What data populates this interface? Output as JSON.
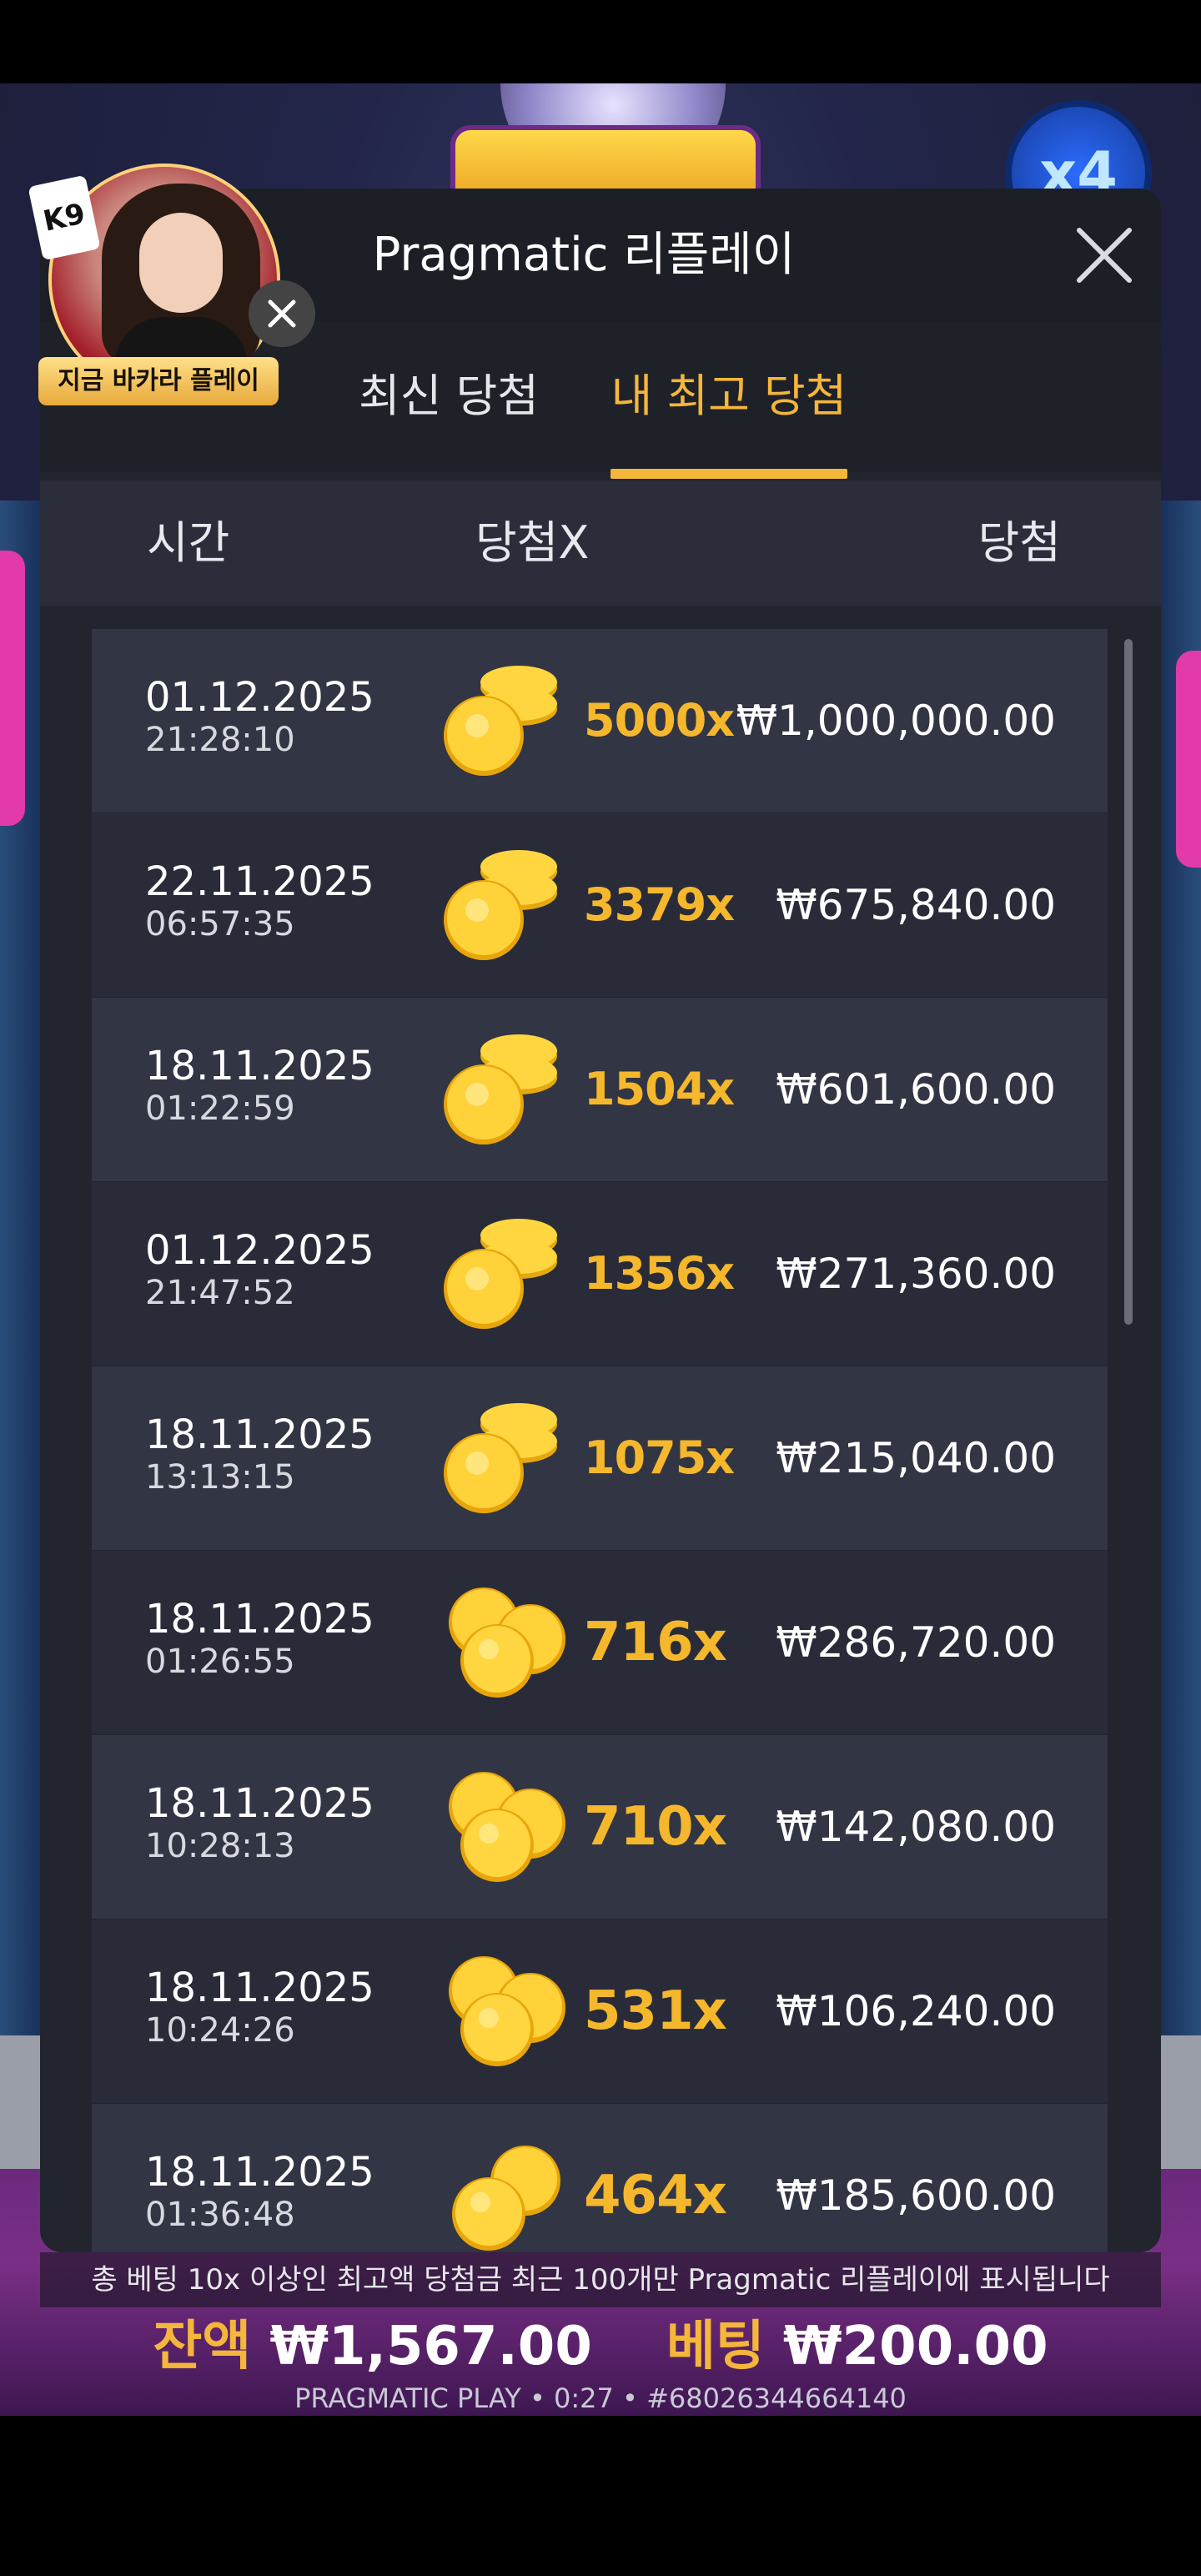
{
  "modal": {
    "title": "Pragmatic 리플레이",
    "tabs": [
      {
        "label": "최신 당첨",
        "active": false
      },
      {
        "label": "내 최고 당첨",
        "active": true
      }
    ],
    "columns": {
      "time": "시간",
      "multiplier": "당첨X",
      "win": "당첨"
    },
    "rows": [
      {
        "date": "01.12.2025",
        "time": "21:28:10",
        "multiplier": "5000x",
        "win": "₩1,000,000.00",
        "coin_icon": "coin-stack-icon"
      },
      {
        "date": "22.11.2025",
        "time": "06:57:35",
        "multiplier": "3379x",
        "win": "₩675,840.00",
        "coin_icon": "coin-stack-icon"
      },
      {
        "date": "18.11.2025",
        "time": "01:22:59",
        "multiplier": "1504x",
        "win": "₩601,600.00",
        "coin_icon": "coin-stack-icon"
      },
      {
        "date": "01.12.2025",
        "time": "21:47:52",
        "multiplier": "1356x",
        "win": "₩271,360.00",
        "coin_icon": "coin-stack-icon"
      },
      {
        "date": "18.11.2025",
        "time": "13:13:15",
        "multiplier": "1075x",
        "win": "₩215,040.00",
        "coin_icon": "coin-stack-icon"
      },
      {
        "date": "18.11.2025",
        "time": "01:26:55",
        "multiplier": "716x",
        "win": "₩286,720.00",
        "coin_icon": "coin-pile-icon"
      },
      {
        "date": "18.11.2025",
        "time": "10:28:13",
        "multiplier": "710x",
        "win": "₩142,080.00",
        "coin_icon": "coin-pile-icon"
      },
      {
        "date": "18.11.2025",
        "time": "10:24:26",
        "multiplier": "531x",
        "win": "₩106,240.00",
        "coin_icon": "coin-pile-icon"
      },
      {
        "date": "18.11.2025",
        "time": "01:36:48",
        "multiplier": "464x",
        "win": "₩185,600.00",
        "coin_icon": "coin-pair-icon"
      }
    ]
  },
  "notice": "총 베팅 10x 이상인 최고액 당첨금 최근 100개만 Pragmatic 리플레이에 표시됩니다",
  "footer": {
    "balance_label": "잔액",
    "balance_value": "₩1,567.00",
    "bet_label": "베팅",
    "bet_value": "₩200.00",
    "info": "PRAGMATIC PLAY • 0:27 • #68026344664140"
  },
  "promo": {
    "label": "지금 바카라 플레이",
    "card_text": "K9"
  },
  "game": {
    "multiplier_badge": "x4"
  },
  "colors": {
    "accent": "#f4b63b",
    "modal_bg": "#23252e",
    "row_bg": "#323543",
    "row_alt_bg": "#292c38"
  }
}
